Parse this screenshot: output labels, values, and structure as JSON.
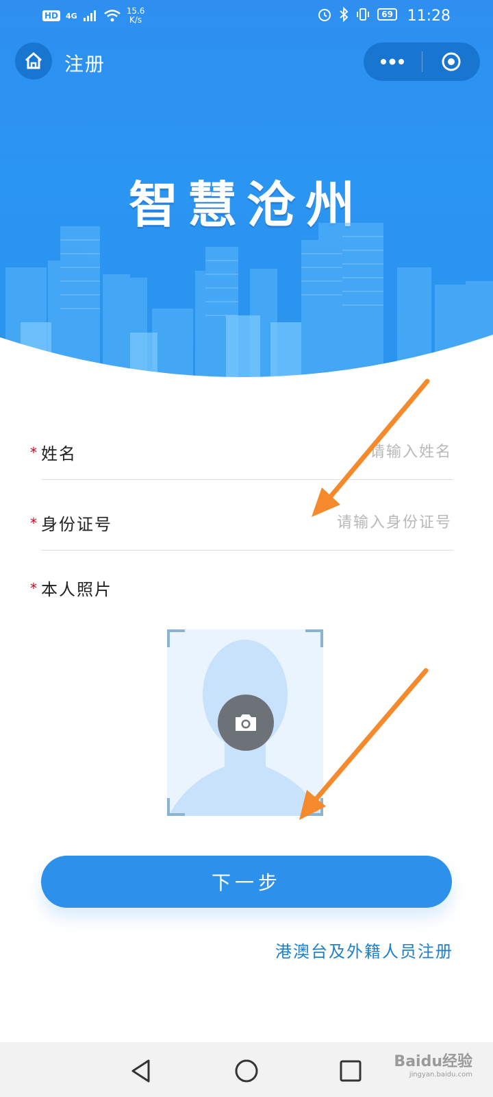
{
  "status_bar": {
    "hd": "HD",
    "network": "4G",
    "speed_value": "15.6",
    "speed_unit": "K/s",
    "battery": "69",
    "time": "11:28"
  },
  "nav": {
    "title": "注册",
    "home_icon": "home-icon",
    "more_icon": "more-icon",
    "close_icon": "target-icon"
  },
  "banner": {
    "title": "智慧沧州"
  },
  "form": {
    "name": {
      "label": "姓名",
      "required_mark": "*",
      "placeholder": "请输入姓名",
      "value": ""
    },
    "id_number": {
      "label": "身份证号",
      "required_mark": "*",
      "placeholder": "请输入身份证号",
      "value": ""
    },
    "photo": {
      "label": "本人照片",
      "required_mark": "*",
      "icon": "camera-icon"
    }
  },
  "actions": {
    "next_label": "下一步",
    "foreign_register_label": "港澳台及外籍人员注册"
  },
  "colors": {
    "primary": "#2d91ec",
    "header": "#2b95f2",
    "required": "#d0021b",
    "link": "#1f7fc8",
    "annotation_arrow": "#f48a2c"
  },
  "system_nav": {
    "back_icon": "back-triangle-icon",
    "home_icon": "home-circle-icon",
    "recent_icon": "recent-square-icon"
  },
  "watermark": {
    "brand": "Baidu经验",
    "url": "jingyan.baidu.com"
  }
}
